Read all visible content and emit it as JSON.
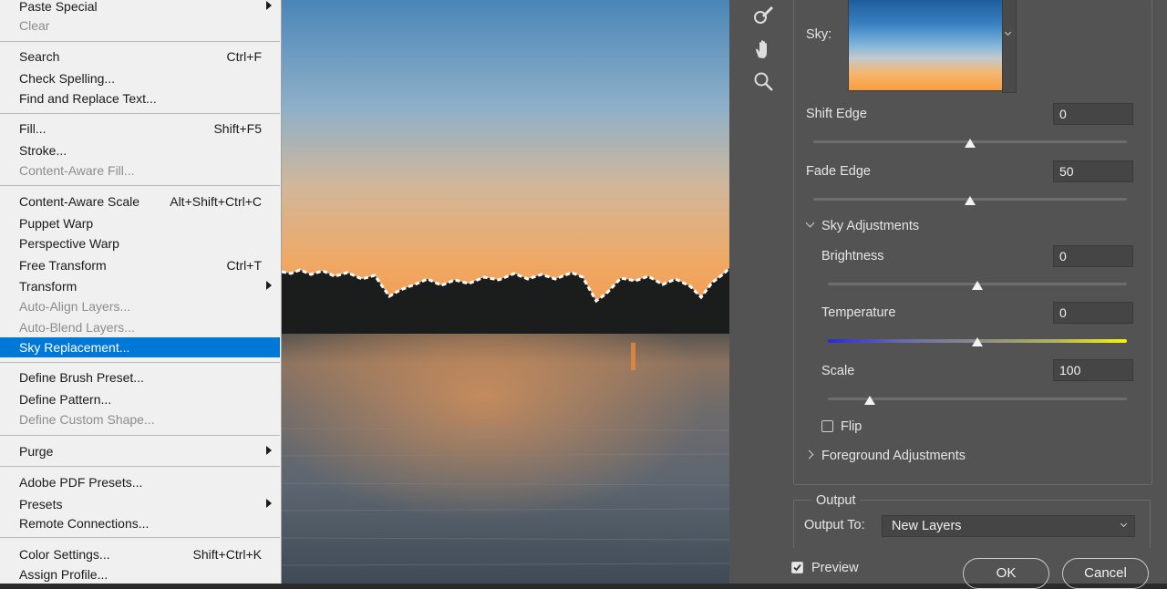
{
  "edit_menu": {
    "items": [
      {
        "label": "Paste Special",
        "shortcut": "",
        "submenu": true,
        "disabled": false,
        "selected": false
      },
      {
        "label": "Clear",
        "shortcut": "",
        "submenu": false,
        "disabled": true,
        "selected": false
      },
      {
        "label": "Search",
        "shortcut": "Ctrl+F",
        "submenu": false,
        "disabled": false,
        "selected": false
      },
      {
        "label": "Check Spelling...",
        "shortcut": "",
        "submenu": false,
        "disabled": false,
        "selected": false
      },
      {
        "label": "Find and Replace Text...",
        "shortcut": "",
        "submenu": false,
        "disabled": false,
        "selected": false
      },
      {
        "label": "Fill...",
        "shortcut": "Shift+F5",
        "submenu": false,
        "disabled": false,
        "selected": false
      },
      {
        "label": "Stroke...",
        "shortcut": "",
        "submenu": false,
        "disabled": false,
        "selected": false
      },
      {
        "label": "Content-Aware Fill...",
        "shortcut": "",
        "submenu": false,
        "disabled": true,
        "selected": false
      },
      {
        "label": "Content-Aware Scale",
        "shortcut": "Alt+Shift+Ctrl+C",
        "submenu": false,
        "disabled": false,
        "selected": false
      },
      {
        "label": "Puppet Warp",
        "shortcut": "",
        "submenu": false,
        "disabled": false,
        "selected": false
      },
      {
        "label": "Perspective Warp",
        "shortcut": "",
        "submenu": false,
        "disabled": false,
        "selected": false
      },
      {
        "label": "Free Transform",
        "shortcut": "Ctrl+T",
        "submenu": false,
        "disabled": false,
        "selected": false
      },
      {
        "label": "Transform",
        "shortcut": "",
        "submenu": true,
        "disabled": false,
        "selected": false
      },
      {
        "label": "Auto-Align Layers...",
        "shortcut": "",
        "submenu": false,
        "disabled": true,
        "selected": false
      },
      {
        "label": "Auto-Blend Layers...",
        "shortcut": "",
        "submenu": false,
        "disabled": true,
        "selected": false
      },
      {
        "label": "Sky Replacement...",
        "shortcut": "",
        "submenu": false,
        "disabled": false,
        "selected": true
      },
      {
        "label": "Define Brush Preset...",
        "shortcut": "",
        "submenu": false,
        "disabled": false,
        "selected": false
      },
      {
        "label": "Define Pattern...",
        "shortcut": "",
        "submenu": false,
        "disabled": false,
        "selected": false
      },
      {
        "label": "Define Custom Shape...",
        "shortcut": "",
        "submenu": false,
        "disabled": true,
        "selected": false
      },
      {
        "label": "Purge",
        "shortcut": "",
        "submenu": true,
        "disabled": false,
        "selected": false
      },
      {
        "label": "Adobe PDF Presets...",
        "shortcut": "",
        "submenu": false,
        "disabled": false,
        "selected": false
      },
      {
        "label": "Presets",
        "shortcut": "",
        "submenu": true,
        "disabled": false,
        "selected": false
      },
      {
        "label": "Remote Connections...",
        "shortcut": "",
        "submenu": false,
        "disabled": false,
        "selected": false
      },
      {
        "label": "Color Settings...",
        "shortcut": "Shift+Ctrl+K",
        "submenu": false,
        "disabled": false,
        "selected": false
      },
      {
        "label": "Assign Profile...",
        "shortcut": "",
        "submenu": false,
        "disabled": false,
        "selected": false
      }
    ],
    "selected_color": "#0078d7"
  },
  "tools": [
    {
      "name": "sky-brush-icon"
    },
    {
      "name": "hand-icon"
    },
    {
      "name": "zoom-icon"
    }
  ],
  "sky_replacement": {
    "sky_label": "Sky:",
    "shift_edge": {
      "label": "Shift Edge",
      "value": "0",
      "level": 0.5
    },
    "fade_edge": {
      "label": "Fade Edge",
      "value": "50",
      "level": 0.5
    },
    "sky_adjustments": {
      "label": "Sky Adjustments",
      "brightness": {
        "label": "Brightness",
        "value": "0",
        "level": 0.5
      },
      "temperature": {
        "label": "Temperature",
        "value": "0",
        "level": 0.5
      },
      "scale": {
        "label": "Scale",
        "value": "100",
        "level": 0.14
      },
      "flip": {
        "label": "Flip",
        "checked": false
      }
    },
    "foreground_adjustments": {
      "label": "Foreground Adjustments"
    },
    "output": {
      "section_label": "Output",
      "output_to_label": "Output To:",
      "output_to_value": "New Layers"
    },
    "preview": {
      "label": "Preview",
      "checked": true
    },
    "ok_label": "OK",
    "cancel_label": "Cancel"
  }
}
